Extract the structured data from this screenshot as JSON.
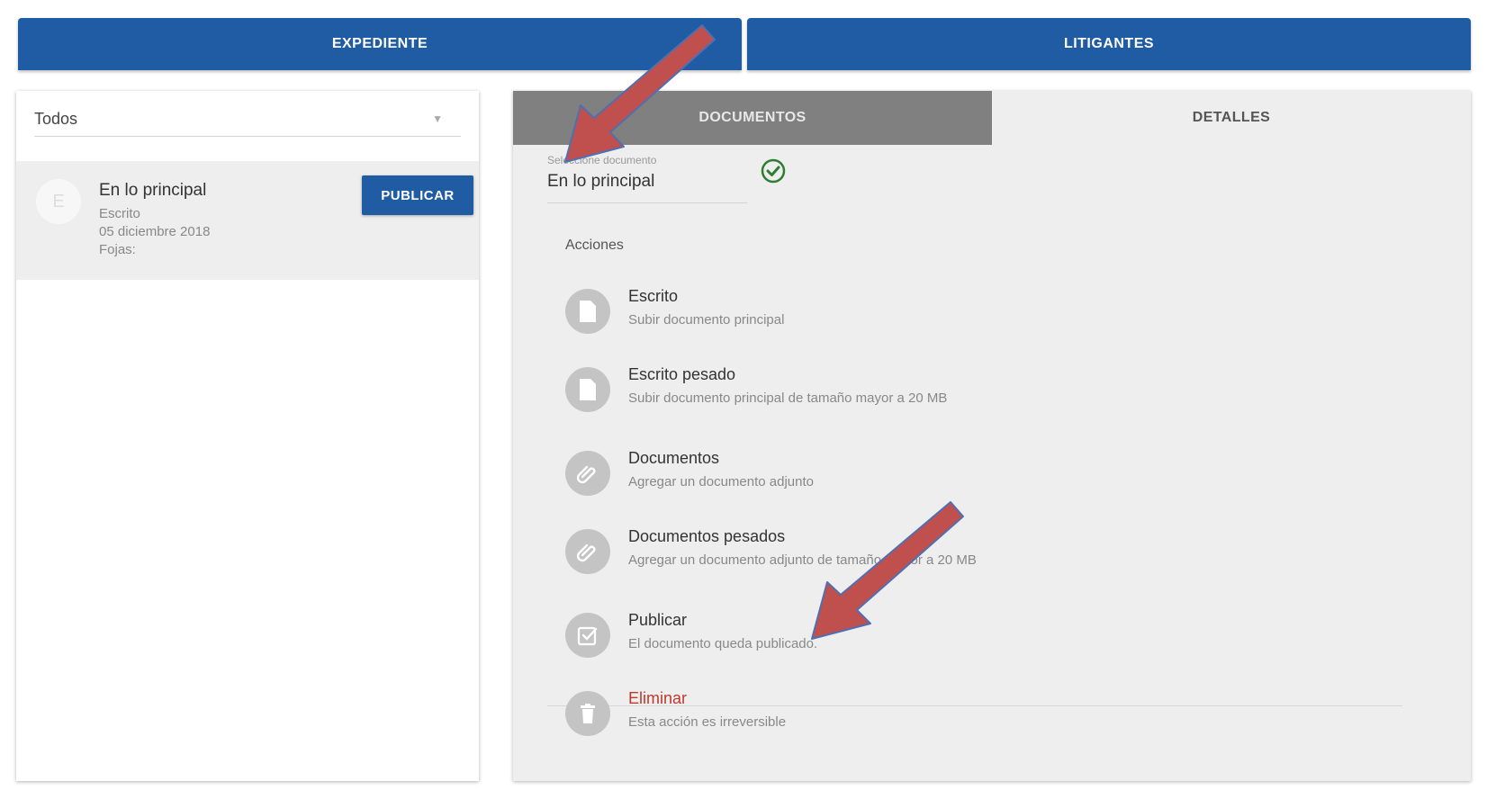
{
  "top_tabs": {
    "expediente": "EXPEDIENTE",
    "litigantes": "LITIGANTES"
  },
  "left": {
    "filter_value": "Todos",
    "item": {
      "avatar_letter": "E",
      "title": "En lo principal",
      "type": "Escrito",
      "date": "05 diciembre 2018",
      "fojas": "Fojas:",
      "publish_label": "PUBLICAR"
    }
  },
  "right": {
    "tabs": {
      "documentos": "DOCUMENTOS",
      "detalles": "DETALLES"
    },
    "field_label": "Seleccione documento",
    "field_value": "En lo principal",
    "acciones_label": "Acciones",
    "actions": [
      {
        "title": "Escrito",
        "subtitle": "Subir documento principal",
        "icon": "file-icon"
      },
      {
        "title": "Escrito pesado",
        "subtitle": "Subir documento principal de tamaño mayor a 20 MB",
        "icon": "file-icon"
      },
      {
        "title": "Documentos",
        "subtitle": "Agregar un documento adjunto",
        "icon": "paperclip-icon"
      },
      {
        "title": "Documentos pesados",
        "subtitle": "Agregar un documento adjunto de tamaño mayor a 20 MB",
        "icon": "paperclip-icon"
      },
      {
        "title": "Publicar",
        "subtitle": "El documento queda publicado.",
        "icon": "checkbox-icon"
      },
      {
        "title": "Eliminar",
        "subtitle": "Esta acción es irreversible",
        "icon": "trash-icon"
      }
    ]
  },
  "colors": {
    "primary": "#1f5ca3",
    "tab_active": "#808080",
    "annotation_arrow": "#c0504d",
    "check": "#2e7d32",
    "danger": "#c0392b"
  }
}
